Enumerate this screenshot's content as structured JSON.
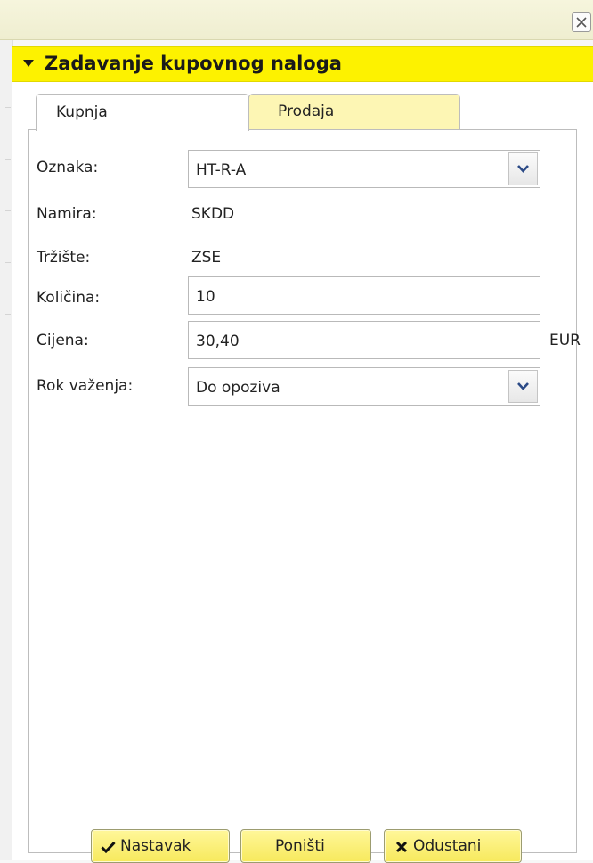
{
  "window": {
    "close_icon": "close-icon"
  },
  "dialog": {
    "title": "Zadavanje kupovnog naloga",
    "header_color": "#fdf200"
  },
  "tabs": [
    {
      "label": "Kupnja",
      "active": true
    },
    {
      "label": "Prodaja",
      "active": false
    }
  ],
  "form": {
    "oznaka": {
      "label": "Oznaka:",
      "value": "HT-R-A"
    },
    "namira": {
      "label": "Namira:",
      "value": "SKDD"
    },
    "trziste": {
      "label": "Tržište:",
      "value": "ZSE"
    },
    "kolicina": {
      "label": "Količina:",
      "value": "10"
    },
    "cijena": {
      "label": "Cijena:",
      "value": "30,40",
      "unit": "EUR"
    },
    "rok": {
      "label": "Rok važenja:",
      "value": "Do opoziva"
    }
  },
  "buttons": {
    "nastavak": "Nastavak",
    "ponisti": "Poništi",
    "odustani": "Odustani"
  }
}
